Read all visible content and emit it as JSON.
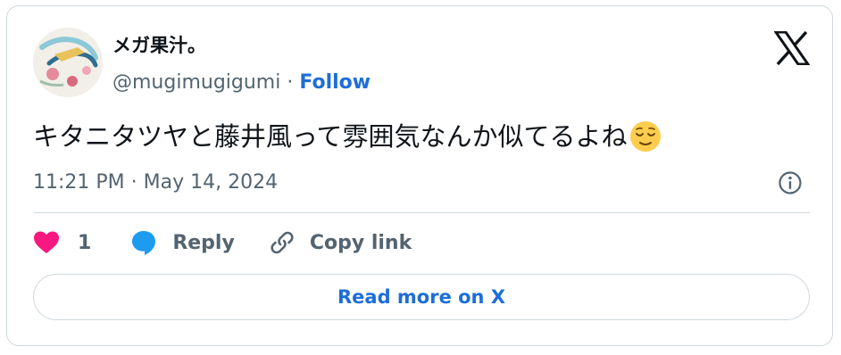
{
  "author": {
    "display_name": "メガ果汁。",
    "handle": "@mugimugigumi",
    "separator": " · ",
    "follow_label": "Follow"
  },
  "tweet": {
    "text": "キタニタツヤと藤井風って雰囲気なんか似てるよね",
    "trailing_emoji": "relieved-face-emoji",
    "timestamp": "11:21 PM · May 14, 2024"
  },
  "actions": {
    "like_count": "1",
    "reply_label": "Reply",
    "copy_link_label": "Copy link"
  },
  "footer": {
    "read_more_label": "Read more on X"
  },
  "icons": {
    "brand": "x-logo-icon",
    "info": "info-icon",
    "like": "heart-icon",
    "reply": "speech-bubble-icon",
    "copy": "link-icon"
  },
  "colors": {
    "text_primary": "#0f1419",
    "text_secondary": "#536471",
    "link_blue": "#1d6ed8",
    "heart_red": "#f91880",
    "reply_blue": "#1d9bf0",
    "border": "#cfd9de"
  }
}
